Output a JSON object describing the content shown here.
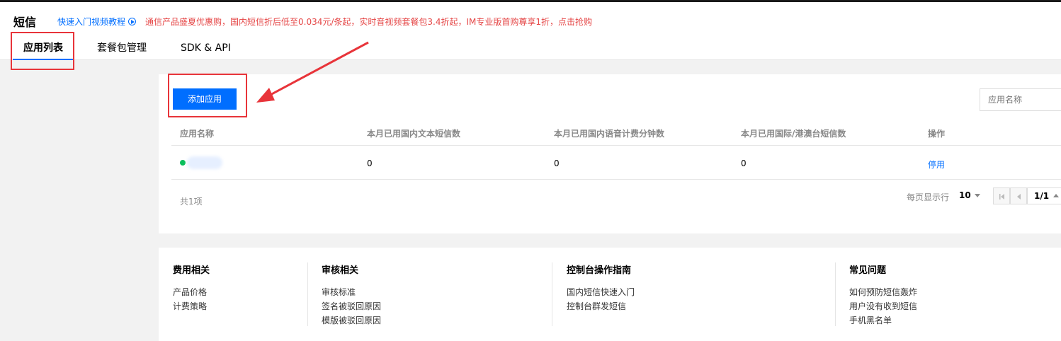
{
  "header": {
    "title": "短信",
    "video_link": "快速入门视频教程",
    "promo": "通信产品盛夏优惠购，国内短信折后低至0.034元/条起，实时音视频套餐包3.4折起，IM专业版首购尊享1折，点击抢购",
    "tabs": [
      {
        "label": "应用列表",
        "active": true
      },
      {
        "label": "套餐包管理",
        "active": false
      },
      {
        "label": "SDK & API",
        "active": false
      }
    ]
  },
  "main": {
    "add_button": "添加应用",
    "search_placeholder": "应用名称",
    "columns": [
      "应用名称",
      "本月已用国内文本短信数",
      "本月已用国内语音计费分钟数",
      "本月已用国际/港澳台短信数",
      "操作"
    ],
    "rows": [
      {
        "status": "active",
        "text_sms": "0",
        "voice_minutes": "0",
        "intl_sms": "0",
        "action": "停用"
      }
    ],
    "total": "共1项",
    "page_size_label": "每页显示行",
    "page_size": "10",
    "page": "1/1"
  },
  "footer": {
    "columns": [
      {
        "title": "费用相关",
        "links": [
          "产品价格",
          "计费策略"
        ]
      },
      {
        "title": "审核相关",
        "links": [
          "审核标准",
          "签名被驳回原因",
          "模版被驳回原因"
        ]
      },
      {
        "title": "控制台操作指南",
        "links": [
          "国内短信快速入门",
          "控制台群发短信"
        ]
      },
      {
        "title": "常见问题",
        "links": [
          "如何预防短信轰炸",
          "用户没有收到短信",
          "手机黑名单"
        ]
      }
    ]
  },
  "colors": {
    "accent": "#006eff",
    "promo": "#e54545",
    "status_active": "#0abf5b",
    "annotation": "#e8343a"
  }
}
